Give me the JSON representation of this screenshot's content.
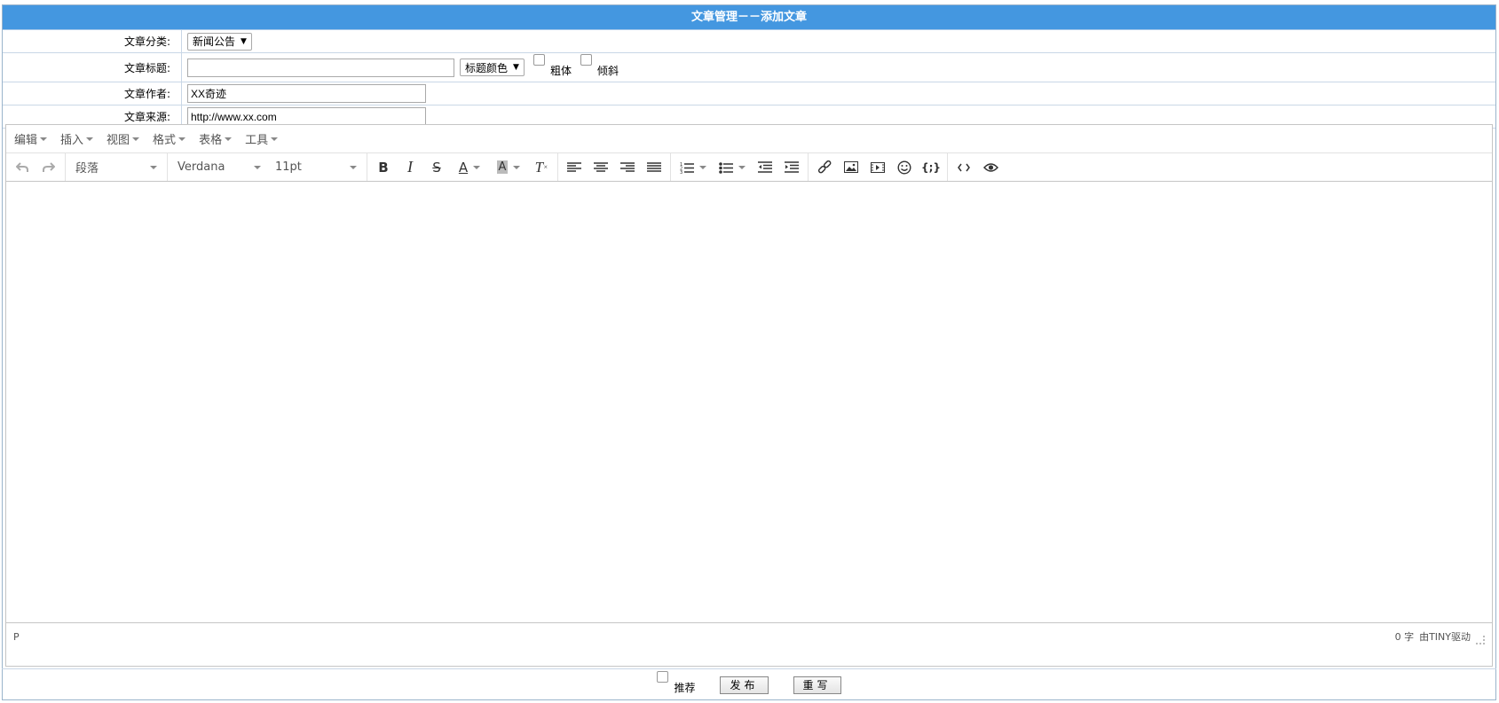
{
  "title": "文章管理－－添加文章",
  "form": {
    "category": {
      "label": "文章分类:",
      "value": "新闻公告"
    },
    "title": {
      "label": "文章标题:",
      "value": "",
      "color_select": "标题颜色",
      "bold_label": "粗体",
      "italic_label": "倾斜"
    },
    "author": {
      "label": "文章作者:",
      "value": "XX奇迹"
    },
    "source": {
      "label": "文章来源:",
      "value": "http://www.xx.com"
    }
  },
  "editor": {
    "menu": [
      "编辑",
      "插入",
      "视图",
      "格式",
      "表格",
      "工具"
    ],
    "toolbar": {
      "block_format": "段落",
      "font_family": "Verdana",
      "font_size": "11pt"
    },
    "icons": [
      "undo-icon",
      "redo-icon",
      "bold-icon",
      "italic-icon",
      "strikethrough-icon",
      "text-color-icon",
      "background-color-icon",
      "clear-formatting-icon",
      "align-left-icon",
      "align-center-icon",
      "align-right-icon",
      "align-justify-icon",
      "numbered-list-icon",
      "bulleted-list-icon",
      "outdent-icon",
      "indent-icon",
      "link-icon",
      "image-icon",
      "media-icon",
      "emoticon-icon",
      "code-sample-icon",
      "source-code-icon",
      "preview-icon"
    ],
    "status": {
      "path": "P",
      "word_count": "0 字",
      "powered_by": "由TINY驱动"
    }
  },
  "footer": {
    "recommend_label": "推荐",
    "publish_label": "发布",
    "reset_label": "重写"
  },
  "colors": {
    "title_bar": "#4497e0",
    "border": "#c9d7e6"
  }
}
